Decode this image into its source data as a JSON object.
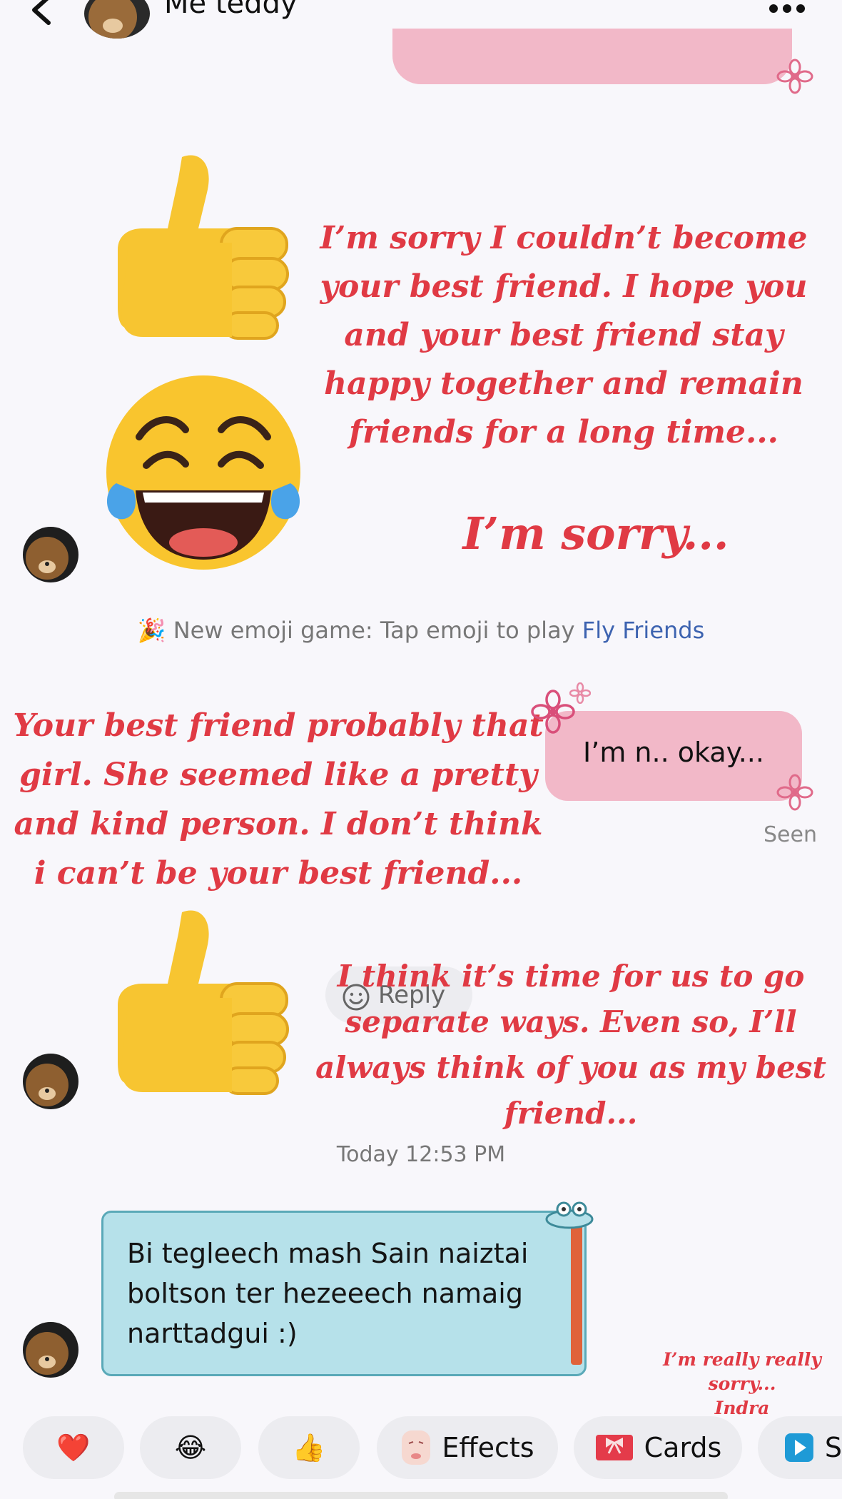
{
  "header": {
    "title": "Me teddy"
  },
  "messages": {
    "first_sticker_text": "I’m sorry I couldn’t become your best friend. I hope you and your best friend stay happy together and remain friends for a long time...",
    "sorry_text": "I’m sorry...",
    "system_prefix": "New emoji game: Tap emoji to play ",
    "system_link": "Fly Friends",
    "left_text": "Your best friend probably that girl. She seemed like a pretty and kind person. I don’t think i can’t be your best friend...",
    "my_bubble": "I’m n.. okay...",
    "seen": "Seen",
    "reply_label": "Reply",
    "ways_text": "I think it’s time for us to go separate ways. Even so, I’ll always think of you as my best friend...",
    "timestamp": "Today 12:53 PM",
    "card_text": "Bi tegleech mash Sain naiztai boltson ter hezeeech namaig narttadgui :)",
    "signature_line1": "I’m really really sorry...",
    "signature_line2": "Indra"
  },
  "toolbar": {
    "heart": "❤️",
    "laugh": "😂",
    "thumbs": "👍",
    "effects_label": "Effects",
    "cards_label": "Cards",
    "partial_label": "S"
  },
  "colors": {
    "accent_red": "#e03a44",
    "pink_bubble": "#f2b8c8",
    "card_bg": "#b6e1ea",
    "link": "#3d63b0"
  }
}
